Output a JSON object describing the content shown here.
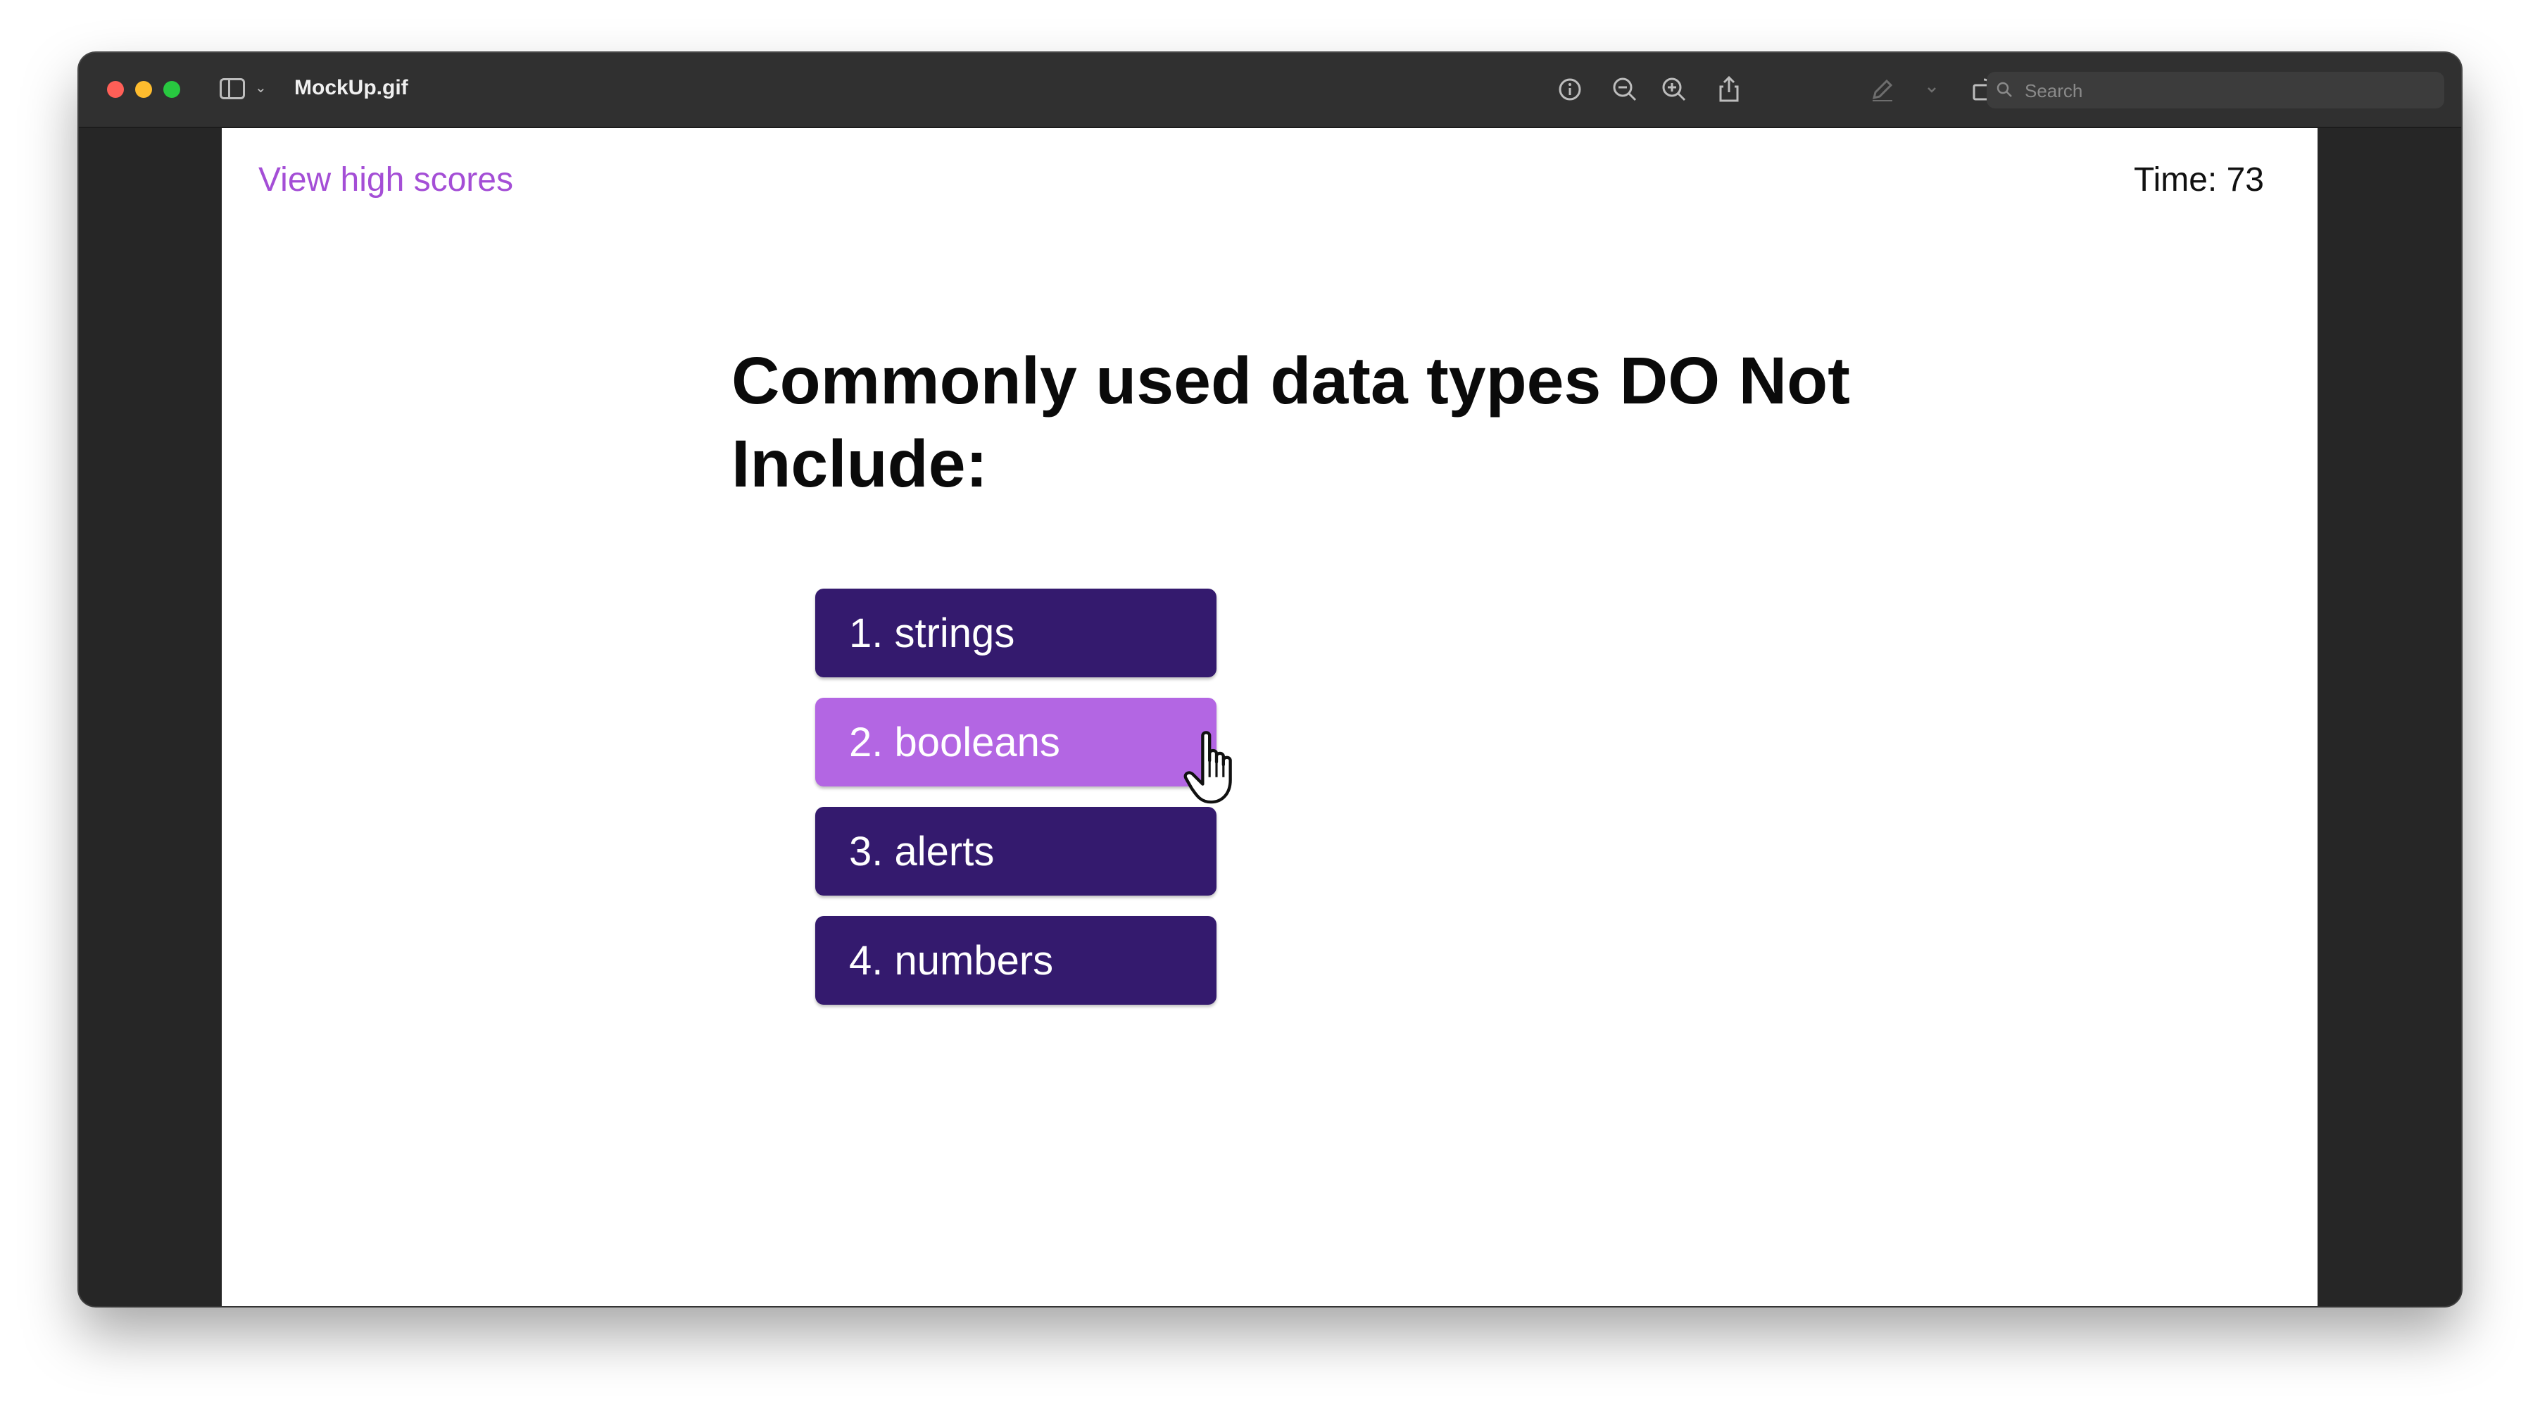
{
  "window": {
    "title": "MockUp.gif"
  },
  "toolbar": {
    "icons": [
      "info-icon",
      "zoom-out-icon",
      "zoom-in-icon",
      "share-icon",
      "markup-pen-icon",
      "chevron-down-icon",
      "rotate-icon",
      "annotate-icon"
    ],
    "search_placeholder": "Search"
  },
  "quiz": {
    "high_scores_link": "View high scores",
    "timer_text": "Time: 73",
    "question": "Commonly used data types DO Not Include:",
    "answers": [
      {
        "label": "1. strings"
      },
      {
        "label": "2. booleans",
        "hovered": true
      },
      {
        "label": "3. alerts"
      },
      {
        "label": "4. numbers"
      }
    ]
  },
  "colors": {
    "answer_bg": "#341a6e",
    "answer_hover_bg": "#b366e3",
    "link": "#a44ed6"
  }
}
